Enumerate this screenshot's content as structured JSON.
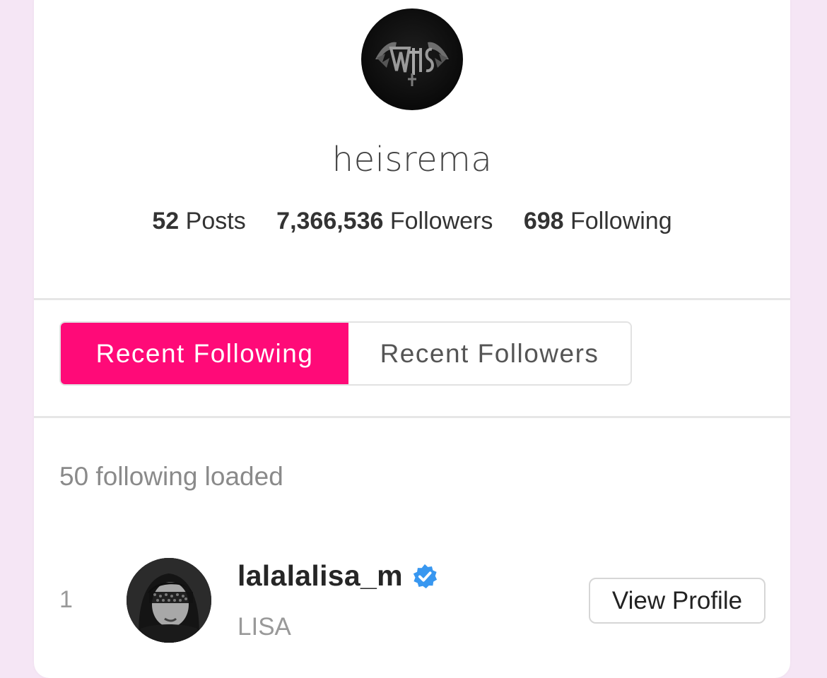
{
  "profile": {
    "username": "heisrema",
    "stats": [
      {
        "count": "52",
        "label": "Posts"
      },
      {
        "count": "7,366,536",
        "label": "Followers"
      },
      {
        "count": "698",
        "label": "Following"
      }
    ]
  },
  "tabs": {
    "recent_following": "Recent Following",
    "recent_followers": "Recent Followers",
    "active": "recent_following"
  },
  "list": {
    "status": "50 following loaded",
    "items": [
      {
        "index": "1",
        "username": "lalalalisa_m",
        "verified": true,
        "full_name": "LISA",
        "button_label": "View Profile"
      }
    ]
  },
  "colors": {
    "accent": "#ff0a78",
    "background": "#f5e6f5",
    "verified": "#3897f0"
  }
}
